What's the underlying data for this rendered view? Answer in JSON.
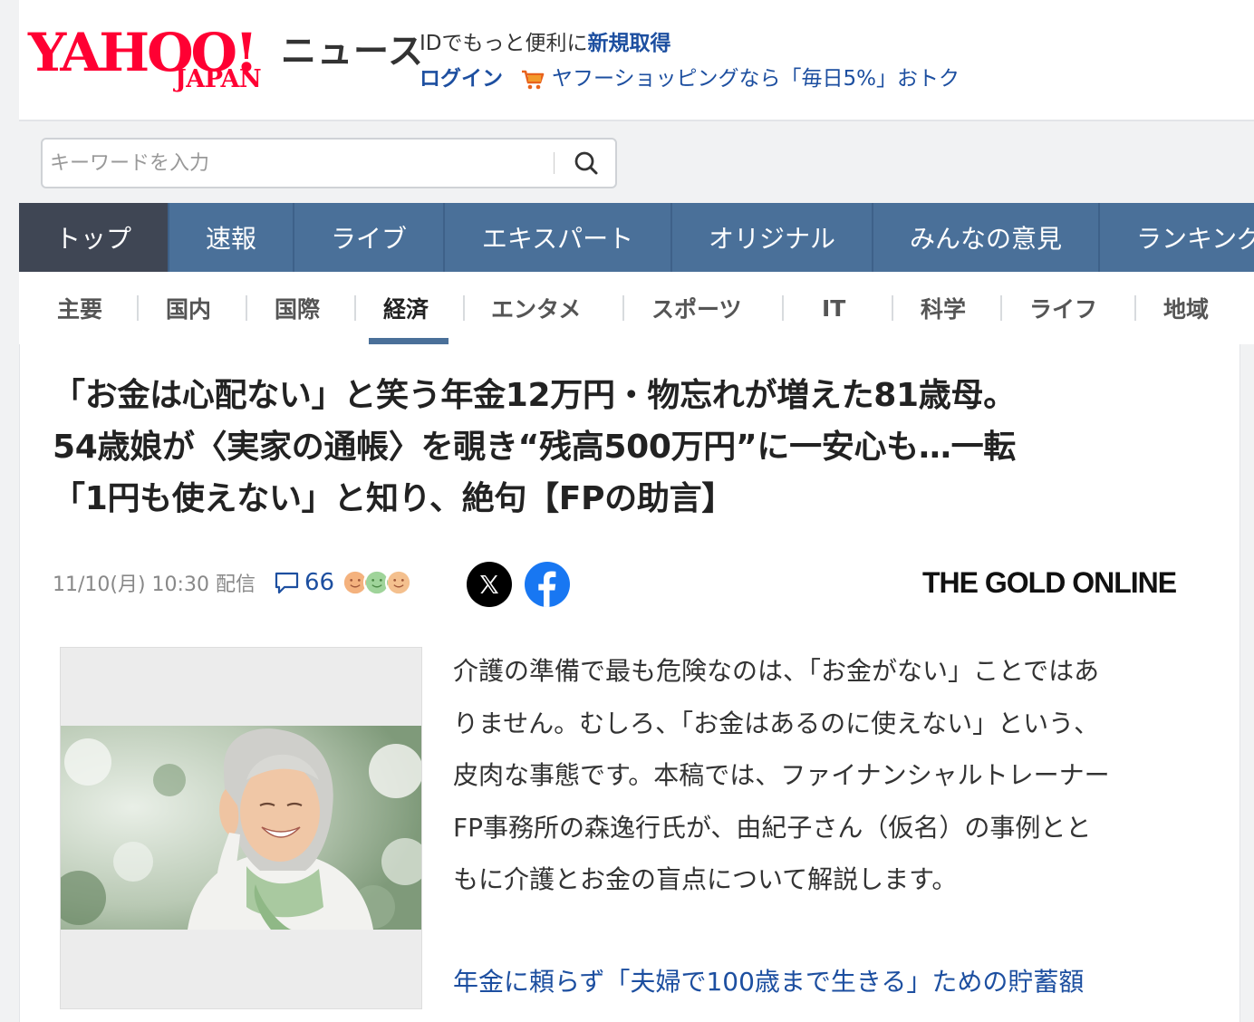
{
  "header": {
    "logo_text": "YAHOO!",
    "logo_sub": "JAPAN",
    "service_name": "ニュース",
    "promo_line1_prefix": "IDでもっと便利に",
    "promo_line1_link": "新規取得",
    "login_label": "ログイン",
    "shopping_promo": "ヤフーショッピングなら「毎日5%」おトク"
  },
  "search": {
    "placeholder": "キーワードを入力",
    "value": ""
  },
  "main_nav": {
    "items": [
      "トップ",
      "速報",
      "ライブ",
      "エキスパート",
      "オリジナル",
      "みんなの意見",
      "ランキング"
    ],
    "active": "トップ"
  },
  "sub_nav": {
    "items": [
      "主要",
      "国内",
      "国際",
      "経済",
      "エンタメ",
      "スポーツ",
      "IT",
      "科学",
      "ライフ",
      "地域"
    ],
    "active": "経済"
  },
  "article": {
    "title_lines": [
      "「お金は心配ない」と笑う年金12万円・物忘れが増えた81歳母。",
      "54歳娘が〈実家の通帳〉を覗き“残高500万円”に一安心も…一転",
      "「1円も使えない」と知り、絶句【FPの助言】"
    ],
    "date": "11/10(月) 10:30 配信",
    "comment_count": "66",
    "publisher": "THE GOLD ONLINE",
    "lead_lines": [
      "介護の準備で最も危険なのは、「お金がない」ことではあ",
      "りません。むしろ、「お金はあるのに使えない」という、",
      "皮肉な事態です。本稿では、ファイナンシャルトレーナー",
      "FP事務所の森逸行氏が、由紀子さん（仮名）の事例とと",
      "もに介護とお金の盲点について解説します。"
    ],
    "related_link": "年金に頼らず「夫婦で100歳まで生きる」ための貯蓄額"
  },
  "colors": {
    "brand_red": "#ff0033",
    "nav_blue": "#4a7099",
    "nav_active": "#3f4654",
    "link_blue": "#1d4fa0"
  }
}
